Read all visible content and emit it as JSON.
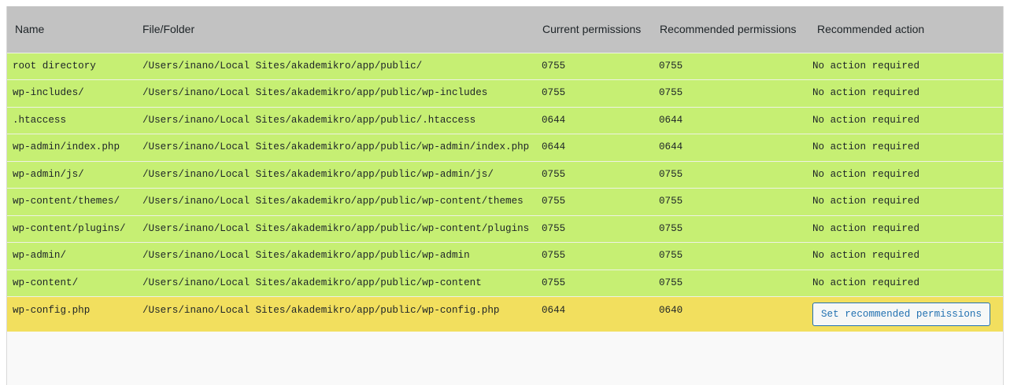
{
  "table": {
    "headers": {
      "name": "Name",
      "path": "File/Folder",
      "current": "Current permissions",
      "recommended": "Recommended permissions",
      "action": "Recommended action"
    },
    "rows": [
      {
        "name": "root directory",
        "path": "/Users/inano/Local Sites/akademikro/app/public/",
        "current": "0755",
        "recommended": "0755",
        "action": "No action required",
        "status": "ok"
      },
      {
        "name": "wp-includes/",
        "path": "/Users/inano/Local Sites/akademikro/app/public/wp-includes",
        "current": "0755",
        "recommended": "0755",
        "action": "No action required",
        "status": "ok"
      },
      {
        "name": ".htaccess",
        "path": "/Users/inano/Local Sites/akademikro/app/public/.htaccess",
        "current": "0644",
        "recommended": "0644",
        "action": "No action required",
        "status": "ok"
      },
      {
        "name": "wp-admin/index.php",
        "path": "/Users/inano/Local Sites/akademikro/app/public/wp-admin/index.php",
        "current": "0644",
        "recommended": "0644",
        "action": "No action required",
        "status": "ok"
      },
      {
        "name": "wp-admin/js/",
        "path": "/Users/inano/Local Sites/akademikro/app/public/wp-admin/js/",
        "current": "0755",
        "recommended": "0755",
        "action": "No action required",
        "status": "ok"
      },
      {
        "name": "wp-content/themes/",
        "path": "/Users/inano/Local Sites/akademikro/app/public/wp-content/themes",
        "current": "0755",
        "recommended": "0755",
        "action": "No action required",
        "status": "ok"
      },
      {
        "name": "wp-content/plugins/",
        "path": "/Users/inano/Local Sites/akademikro/app/public/wp-content/plugins",
        "current": "0755",
        "recommended": "0755",
        "action": "No action required",
        "status": "ok"
      },
      {
        "name": "wp-admin/",
        "path": "/Users/inano/Local Sites/akademikro/app/public/wp-admin",
        "current": "0755",
        "recommended": "0755",
        "action": "No action required",
        "status": "ok"
      },
      {
        "name": "wp-content/",
        "path": "/Users/inano/Local Sites/akademikro/app/public/wp-content",
        "current": "0755",
        "recommended": "0755",
        "action": "No action required",
        "status": "ok"
      },
      {
        "name": "wp-config.php",
        "path": "/Users/inano/Local Sites/akademikro/app/public/wp-config.php",
        "current": "0644",
        "recommended": "0640",
        "action": "Set recommended permissions",
        "status": "warn"
      }
    ]
  },
  "colors": {
    "header_bg": "#c2c2c2",
    "ok_row_bg": "#c6ef73",
    "warn_row_bg": "#f2df5e",
    "button_text": "#2271b1"
  }
}
